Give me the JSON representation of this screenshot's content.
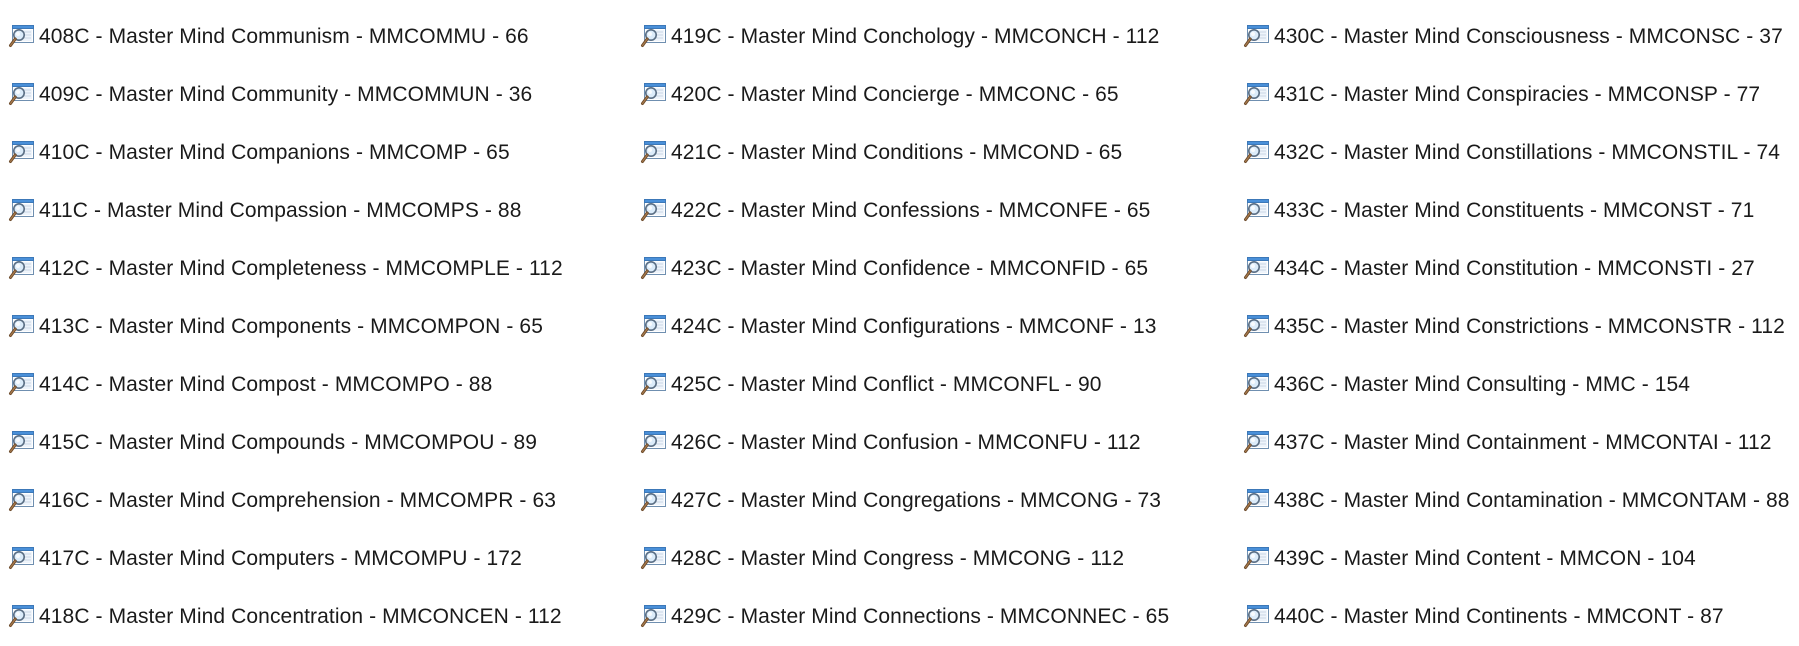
{
  "icon_name": "search-file-icon",
  "columns": [
    {
      "items": [
        {
          "label": "408C - Master Mind Communism - MMCOMMU - 66"
        },
        {
          "label": "409C - Master Mind Community - MMCOMMUN - 36"
        },
        {
          "label": "410C - Master Mind Companions - MMCOMP - 65"
        },
        {
          "label": "411C - Master Mind Compassion - MMCOMPS - 88"
        },
        {
          "label": "412C - Master Mind Completeness - MMCOMPLE - 112"
        },
        {
          "label": "413C - Master Mind Components - MMCOMPON - 65"
        },
        {
          "label": "414C - Master Mind Compost - MMCOMPO - 88"
        },
        {
          "label": "415C - Master Mind Compounds - MMCOMPOU - 89"
        },
        {
          "label": "416C - Master Mind Comprehension - MMCOMPR - 63"
        },
        {
          "label": "417C - Master Mind Computers - MMCOMPU - 172"
        },
        {
          "label": "418C - Master Mind Concentration - MMCONCEN - 112"
        }
      ]
    },
    {
      "items": [
        {
          "label": "419C - Master Mind Conchology - MMCONCH - 112"
        },
        {
          "label": "420C - Master Mind Concierge - MMCONC - 65"
        },
        {
          "label": "421C - Master Mind Conditions - MMCOND - 65"
        },
        {
          "label": "422C - Master Mind Confessions - MMCONFE - 65"
        },
        {
          "label": "423C - Master Mind Confidence - MMCONFID - 65"
        },
        {
          "label": "424C - Master Mind Configurations - MMCONF - 13"
        },
        {
          "label": "425C - Master Mind Conflict - MMCONFL - 90"
        },
        {
          "label": "426C - Master Mind Confusion - MMCONFU - 112"
        },
        {
          "label": "427C - Master Mind Congregations - MMCONG - 73"
        },
        {
          "label": "428C - Master Mind Congress - MMCONG - 112"
        },
        {
          "label": "429C - Master Mind Connections - MMCONNEC - 65"
        }
      ]
    },
    {
      "items": [
        {
          "label": "430C - Master Mind Consciousness - MMCONSC - 37"
        },
        {
          "label": "431C - Master Mind Conspiracies - MMCONSP - 77"
        },
        {
          "label": "432C - Master Mind Constillations - MMCONSTIL - 74"
        },
        {
          "label": "433C - Master Mind Constituents - MMCONST - 71"
        },
        {
          "label": "434C - Master Mind Constitution - MMCONSTI - 27"
        },
        {
          "label": "435C - Master Mind Constrictions - MMCONSTR - 112"
        },
        {
          "label": "436C - Master Mind Consulting - MMC - 154"
        },
        {
          "label": "437C - Master Mind Containment - MMCONTAI - 112"
        },
        {
          "label": "438C - Master Mind Contamination - MMCONTAM - 88"
        },
        {
          "label": "439C - Master Mind Content - MMCON - 104"
        },
        {
          "label": "440C - Master Mind Continents - MMCONT - 87"
        }
      ]
    }
  ]
}
